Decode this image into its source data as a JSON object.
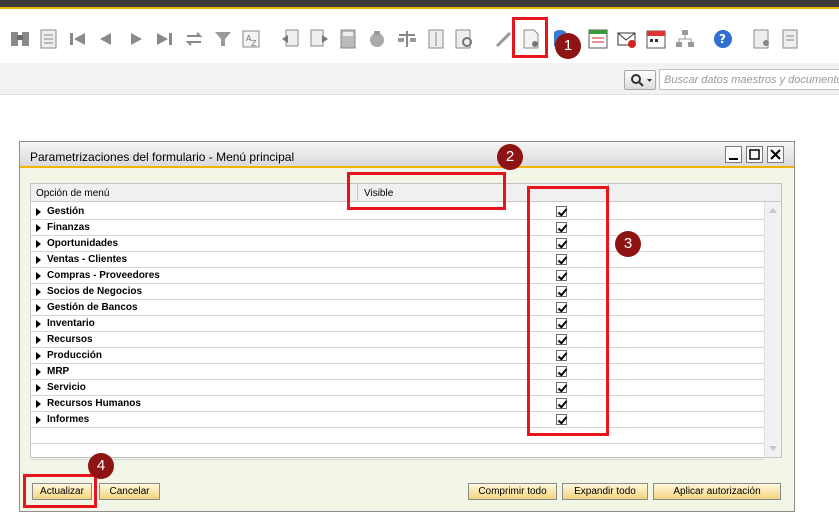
{
  "toolbar": {
    "icons": [
      "binoculars-icon",
      "document-list-icon",
      "first-record-icon",
      "previous-record-icon",
      "next-record-icon",
      "last-record-icon",
      "refresh-icon",
      "filter-icon",
      "sort-icon",
      "base-document-icon",
      "target-document-icon",
      "calculator-icon",
      "money-icon",
      "scale-icon",
      "journal-icon",
      "settings-form-icon",
      "pencil-icon",
      "form-settings-icon",
      "database-icon",
      "checklist-icon",
      "message-icon",
      "calendar-icon",
      "hierarchy-icon",
      "help-icon",
      "print-preview-icon",
      "export-icon"
    ]
  },
  "search": {
    "placeholder": "Buscar datos maestros y documentos"
  },
  "dialog": {
    "title": "Parametrizaciones del formulario - Menú principal",
    "columns": {
      "menu_option": "Opción de menú",
      "visible": "Visible"
    },
    "rows": [
      {
        "label": "Gestión",
        "visible": true
      },
      {
        "label": "Finanzas",
        "visible": true
      },
      {
        "label": "Oportunidades",
        "visible": true
      },
      {
        "label": "Ventas - Clientes",
        "visible": true
      },
      {
        "label": "Compras - Proveedores",
        "visible": true
      },
      {
        "label": "Socios de Negocios",
        "visible": true
      },
      {
        "label": "Gestión de Bancos",
        "visible": true
      },
      {
        "label": "Inventario",
        "visible": true
      },
      {
        "label": "Recursos",
        "visible": true
      },
      {
        "label": "Producción",
        "visible": true
      },
      {
        "label": "MRP",
        "visible": true
      },
      {
        "label": "Servicio",
        "visible": true
      },
      {
        "label": "Recursos Humanos",
        "visible": true
      },
      {
        "label": "Informes",
        "visible": true
      }
    ],
    "buttons": {
      "update": "Actualizar",
      "cancel": "Cancelar",
      "collapse_all": "Comprimir todo",
      "expand_all": "Expandir todo",
      "apply_authorization": "Aplicar autorización"
    }
  },
  "annotations": {
    "marker1": "1",
    "marker2": "2",
    "marker3": "3",
    "marker4": "4"
  },
  "colors": {
    "accent": "#f0b400",
    "annotation_red": "#e8141c",
    "marker_fill": "#8e1414",
    "dialog_bg": "#f1f6e6"
  }
}
